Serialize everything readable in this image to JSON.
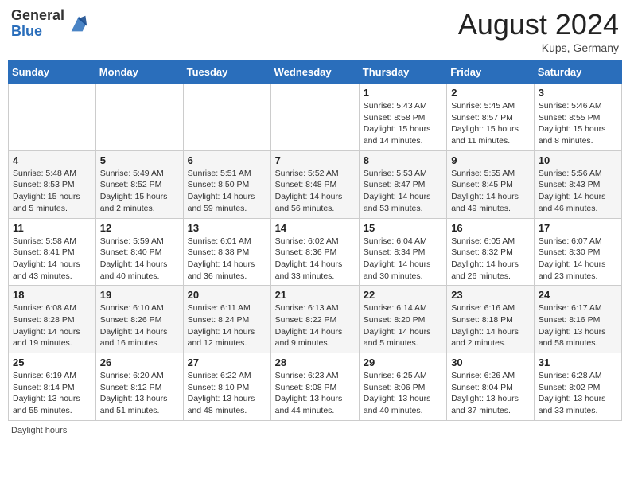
{
  "header": {
    "logo_general": "General",
    "logo_blue": "Blue",
    "month_year": "August 2024",
    "location": "Kups, Germany"
  },
  "days_of_week": [
    "Sunday",
    "Monday",
    "Tuesday",
    "Wednesday",
    "Thursday",
    "Friday",
    "Saturday"
  ],
  "weeks": [
    [
      {
        "day": "",
        "info": ""
      },
      {
        "day": "",
        "info": ""
      },
      {
        "day": "",
        "info": ""
      },
      {
        "day": "",
        "info": ""
      },
      {
        "day": "1",
        "info": "Sunrise: 5:43 AM\nSunset: 8:58 PM\nDaylight: 15 hours and 14 minutes."
      },
      {
        "day": "2",
        "info": "Sunrise: 5:45 AM\nSunset: 8:57 PM\nDaylight: 15 hours and 11 minutes."
      },
      {
        "day": "3",
        "info": "Sunrise: 5:46 AM\nSunset: 8:55 PM\nDaylight: 15 hours and 8 minutes."
      }
    ],
    [
      {
        "day": "4",
        "info": "Sunrise: 5:48 AM\nSunset: 8:53 PM\nDaylight: 15 hours and 5 minutes."
      },
      {
        "day": "5",
        "info": "Sunrise: 5:49 AM\nSunset: 8:52 PM\nDaylight: 15 hours and 2 minutes."
      },
      {
        "day": "6",
        "info": "Sunrise: 5:51 AM\nSunset: 8:50 PM\nDaylight: 14 hours and 59 minutes."
      },
      {
        "day": "7",
        "info": "Sunrise: 5:52 AM\nSunset: 8:48 PM\nDaylight: 14 hours and 56 minutes."
      },
      {
        "day": "8",
        "info": "Sunrise: 5:53 AM\nSunset: 8:47 PM\nDaylight: 14 hours and 53 minutes."
      },
      {
        "day": "9",
        "info": "Sunrise: 5:55 AM\nSunset: 8:45 PM\nDaylight: 14 hours and 49 minutes."
      },
      {
        "day": "10",
        "info": "Sunrise: 5:56 AM\nSunset: 8:43 PM\nDaylight: 14 hours and 46 minutes."
      }
    ],
    [
      {
        "day": "11",
        "info": "Sunrise: 5:58 AM\nSunset: 8:41 PM\nDaylight: 14 hours and 43 minutes."
      },
      {
        "day": "12",
        "info": "Sunrise: 5:59 AM\nSunset: 8:40 PM\nDaylight: 14 hours and 40 minutes."
      },
      {
        "day": "13",
        "info": "Sunrise: 6:01 AM\nSunset: 8:38 PM\nDaylight: 14 hours and 36 minutes."
      },
      {
        "day": "14",
        "info": "Sunrise: 6:02 AM\nSunset: 8:36 PM\nDaylight: 14 hours and 33 minutes."
      },
      {
        "day": "15",
        "info": "Sunrise: 6:04 AM\nSunset: 8:34 PM\nDaylight: 14 hours and 30 minutes."
      },
      {
        "day": "16",
        "info": "Sunrise: 6:05 AM\nSunset: 8:32 PM\nDaylight: 14 hours and 26 minutes."
      },
      {
        "day": "17",
        "info": "Sunrise: 6:07 AM\nSunset: 8:30 PM\nDaylight: 14 hours and 23 minutes."
      }
    ],
    [
      {
        "day": "18",
        "info": "Sunrise: 6:08 AM\nSunset: 8:28 PM\nDaylight: 14 hours and 19 minutes."
      },
      {
        "day": "19",
        "info": "Sunrise: 6:10 AM\nSunset: 8:26 PM\nDaylight: 14 hours and 16 minutes."
      },
      {
        "day": "20",
        "info": "Sunrise: 6:11 AM\nSunset: 8:24 PM\nDaylight: 14 hours and 12 minutes."
      },
      {
        "day": "21",
        "info": "Sunrise: 6:13 AM\nSunset: 8:22 PM\nDaylight: 14 hours and 9 minutes."
      },
      {
        "day": "22",
        "info": "Sunrise: 6:14 AM\nSunset: 8:20 PM\nDaylight: 14 hours and 5 minutes."
      },
      {
        "day": "23",
        "info": "Sunrise: 6:16 AM\nSunset: 8:18 PM\nDaylight: 14 hours and 2 minutes."
      },
      {
        "day": "24",
        "info": "Sunrise: 6:17 AM\nSunset: 8:16 PM\nDaylight: 13 hours and 58 minutes."
      }
    ],
    [
      {
        "day": "25",
        "info": "Sunrise: 6:19 AM\nSunset: 8:14 PM\nDaylight: 13 hours and 55 minutes."
      },
      {
        "day": "26",
        "info": "Sunrise: 6:20 AM\nSunset: 8:12 PM\nDaylight: 13 hours and 51 minutes."
      },
      {
        "day": "27",
        "info": "Sunrise: 6:22 AM\nSunset: 8:10 PM\nDaylight: 13 hours and 48 minutes."
      },
      {
        "day": "28",
        "info": "Sunrise: 6:23 AM\nSunset: 8:08 PM\nDaylight: 13 hours and 44 minutes."
      },
      {
        "day": "29",
        "info": "Sunrise: 6:25 AM\nSunset: 8:06 PM\nDaylight: 13 hours and 40 minutes."
      },
      {
        "day": "30",
        "info": "Sunrise: 6:26 AM\nSunset: 8:04 PM\nDaylight: 13 hours and 37 minutes."
      },
      {
        "day": "31",
        "info": "Sunrise: 6:28 AM\nSunset: 8:02 PM\nDaylight: 13 hours and 33 minutes."
      }
    ]
  ],
  "footer": "Daylight hours"
}
